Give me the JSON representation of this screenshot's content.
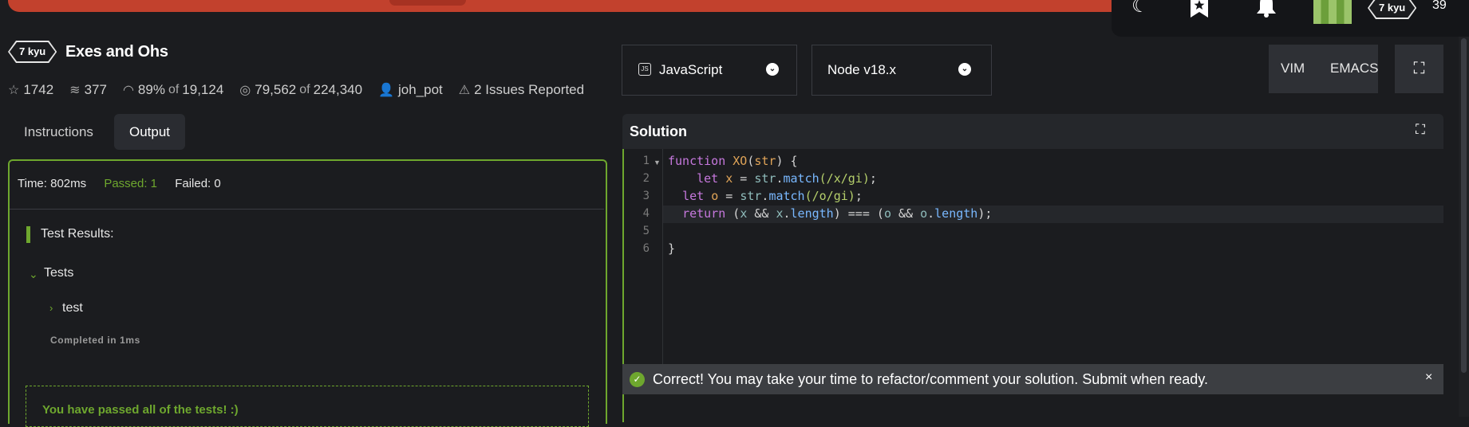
{
  "topbar": {
    "theme_icon": "moon-icon",
    "bookmark_icon": "bookmark-star-icon",
    "notification_icon": "bell-icon",
    "user_rank": "7 kyu",
    "honor": "39"
  },
  "kata": {
    "rank": "7 kyu",
    "title": "Exes and Ohs",
    "stats": {
      "stars": "1742",
      "collections": "377",
      "satisfaction_pct": "89%",
      "of1": "of",
      "votes": "19,124",
      "completions": "79,562",
      "of2": "of",
      "attempts": "224,340",
      "author": "joh_pot",
      "issues": "2 Issues Reported"
    }
  },
  "tabs": {
    "instructions": "Instructions",
    "output": "Output"
  },
  "output": {
    "time": "Time: 802ms",
    "passed": "Passed: 1",
    "failed": "Failed: 0",
    "results_title": "Test Results:",
    "group_label": "Tests",
    "test_label": "test",
    "completed": "Completed in 1ms",
    "passed_message": "You have passed all of the tests! :)"
  },
  "editor_controls": {
    "language": "JavaScript",
    "runtime": "Node v18.x",
    "vim": "VIM",
    "emacs": "EMACS"
  },
  "solution": {
    "title": "Solution",
    "line_numbers": [
      "1",
      "2",
      "3",
      "4",
      "5",
      "6"
    ],
    "code": {
      "l1_kw": "function",
      "l1_fn": "XO",
      "l1_p1": "(",
      "l1_arg": "str",
      "l1_p2": ") {",
      "l2_kw": "let",
      "l2_var": "x",
      "l2_eq": " = ",
      "l2_obj": "str",
      "l2_dot": ".",
      "l2_fn": "match",
      "l2_rx": "(/x/gi)",
      "l2_end": ";",
      "l3_kw": "let",
      "l3_var": "o",
      "l3_eq": " = ",
      "l3_obj": "str",
      "l3_dot": ".",
      "l3_fn": "match",
      "l3_rx": "(/o/gi)",
      "l3_end": ";",
      "l4_kw": "return",
      "l4_a": " (",
      "l4_x": "x",
      "l4_b": " && ",
      "l4_x2": "x",
      "l4_c": ".",
      "l4_len": "length",
      "l4_d": ") === (",
      "l4_o": "o",
      "l4_e": " && ",
      "l4_o2": "o",
      "l4_f": ".",
      "l4_len2": "length",
      "l4_g": ");",
      "l6": "}"
    }
  },
  "notification": {
    "message": "Correct! You may take your time to refactor/comment your solution. Submit when ready.",
    "close": "×"
  }
}
